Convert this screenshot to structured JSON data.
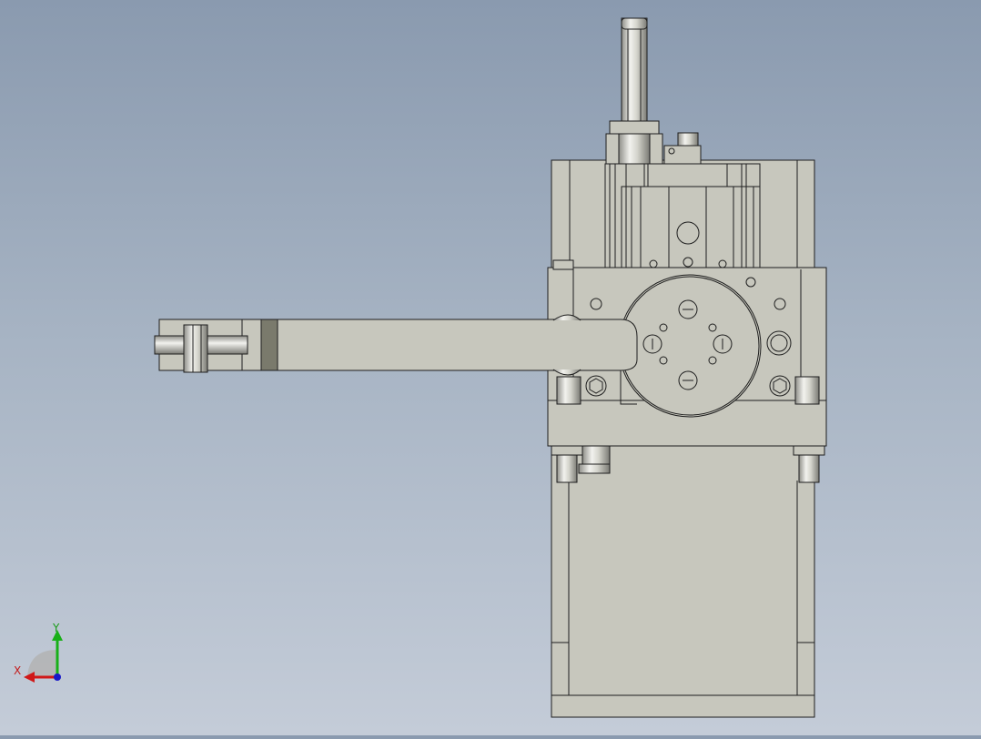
{
  "view": {
    "type": "CAD orthographic view",
    "background_top": "#8a9aaf",
    "background_bottom": "#c4ccd8",
    "part_fill": "#c7c7bd",
    "part_stroke": "#1e1e1e"
  },
  "triad": {
    "x_label": "X",
    "y_label": "Y",
    "x_color": "#d01818",
    "y_color": "#18b018",
    "z_color": "#1818c8"
  }
}
